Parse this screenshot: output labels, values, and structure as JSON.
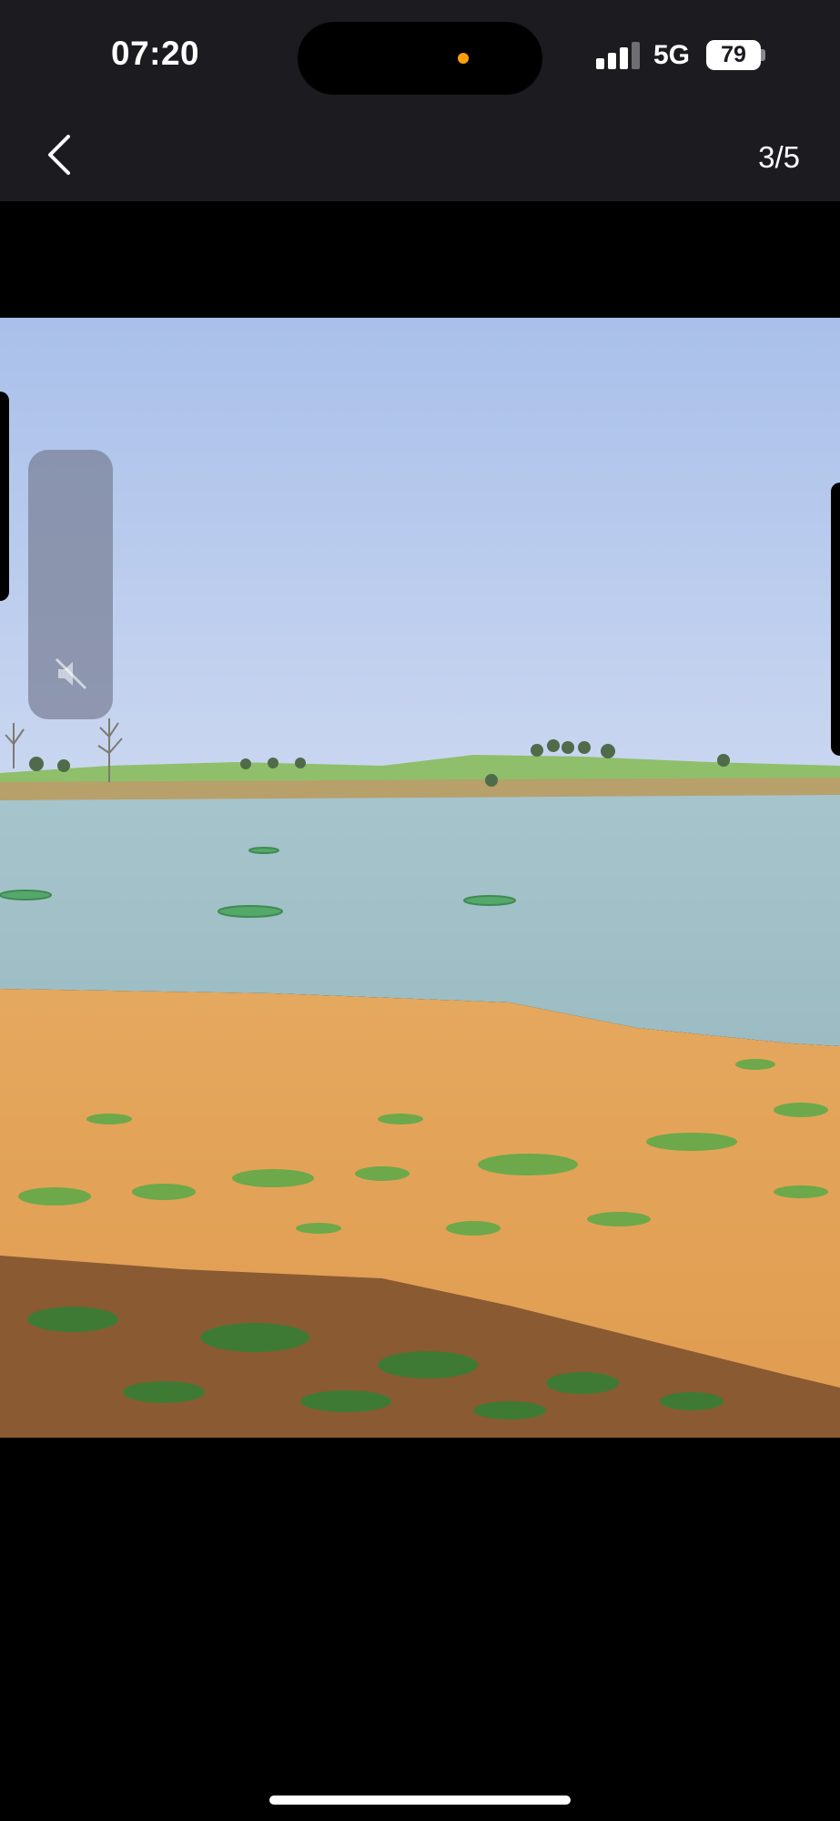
{
  "status_bar": {
    "time": "07:20",
    "network": "5G",
    "battery": "79",
    "signal_bars": 4
  },
  "header": {
    "back_icon": "chevron-left-icon",
    "page_counter": "3/5"
  },
  "media": {
    "description_icon": "speaker-muted-icon",
    "muted": true
  },
  "colors": {
    "header_bg": "#1c1b20",
    "background": "#000000",
    "island_indicator": "#ff9f0a"
  }
}
